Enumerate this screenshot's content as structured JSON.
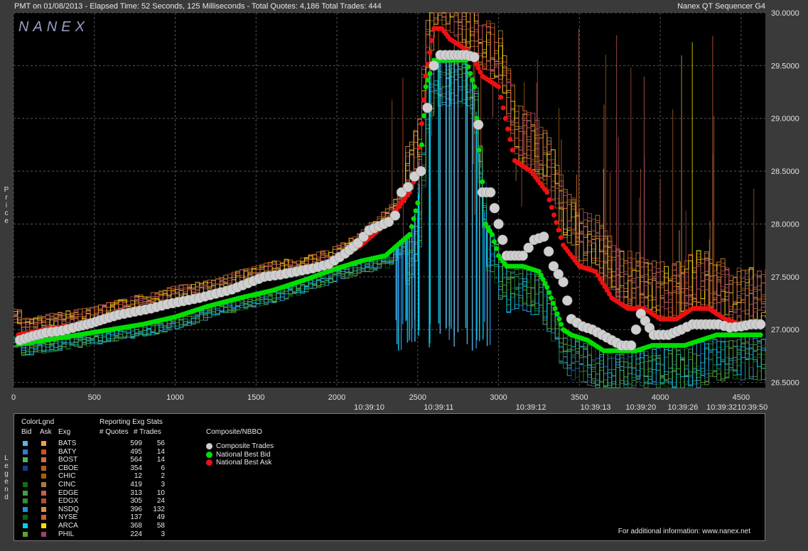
{
  "header": {
    "info": "PMT on 01/08/2013  -  Elapsed Time: 52 Seconds, 125 Milliseconds  -  Total Quotes: 4,186  Total Trades: 444",
    "product": "Nanex QT Sequencer G4",
    "logo": "NANEX"
  },
  "side_labels": {
    "price": "Price",
    "legend": "Legend"
  },
  "colors": {
    "background": "#000000",
    "trades": "#cfcfcf",
    "bid": "#00e000",
    "ask": "#ee1010"
  },
  "chart_data": {
    "type": "scatter",
    "xlim": [
      0,
      4650
    ],
    "ylim": [
      26.45,
      30.0
    ],
    "y_ticks": [
      "30.0000",
      "29.5000",
      "29.0000",
      "28.5000",
      "28.0000",
      "27.5000",
      "27.0000",
      "26.5000"
    ],
    "x_ticks": [
      "0",
      "500",
      "1000",
      "1500",
      "2000",
      "2500",
      "3000",
      "3500",
      "4000",
      "4500"
    ],
    "time_labels": [
      {
        "x": 2200,
        "label": "10:39:10"
      },
      {
        "x": 2630,
        "label": "10:39:11"
      },
      {
        "x": 3200,
        "label": "10:39:12"
      },
      {
        "x": 3600,
        "label": "10:39:13"
      },
      {
        "x": 3880,
        "label": "10:39:20"
      },
      {
        "x": 4140,
        "label": "10:39:26"
      },
      {
        "x": 4380,
        "label": "10:39:32"
      },
      {
        "x": 4570,
        "label": "10:39:50"
      }
    ],
    "series": [
      {
        "name": "Composite Trades",
        "points": [
          [
            40,
            26.9
          ],
          [
            120,
            26.94
          ],
          [
            200,
            26.97
          ],
          [
            300,
            26.99
          ],
          [
            400,
            27.03
          ],
          [
            480,
            27.06
          ],
          [
            560,
            27.1
          ],
          [
            650,
            27.14
          ],
          [
            750,
            27.17
          ],
          [
            850,
            27.2
          ],
          [
            950,
            27.24
          ],
          [
            1050,
            27.27
          ],
          [
            1150,
            27.3
          ],
          [
            1250,
            27.34
          ],
          [
            1350,
            27.38
          ],
          [
            1450,
            27.44
          ],
          [
            1550,
            27.5
          ],
          [
            1650,
            27.52
          ],
          [
            1750,
            27.55
          ],
          [
            1850,
            27.58
          ],
          [
            1950,
            27.62
          ],
          [
            2050,
            27.72
          ],
          [
            2130,
            27.82
          ],
          [
            2200,
            27.94
          ],
          [
            2260,
            27.98
          ],
          [
            2320,
            28.02
          ],
          [
            2360,
            28.08
          ],
          [
            2400,
            28.3
          ],
          [
            2440,
            28.35
          ],
          [
            2480,
            28.45
          ],
          [
            2520,
            28.5
          ],
          [
            2560,
            29.1
          ],
          [
            2600,
            29.5
          ],
          [
            2640,
            29.6
          ],
          [
            2700,
            29.6
          ],
          [
            2750,
            29.6
          ],
          [
            2800,
            29.6
          ],
          [
            2850,
            29.58
          ],
          [
            2900,
            28.3
          ],
          [
            2950,
            28.3
          ],
          [
            3000,
            28.0
          ],
          [
            3050,
            27.7
          ],
          [
            3100,
            27.7
          ],
          [
            3150,
            27.7
          ],
          [
            3220,
            27.85
          ],
          [
            3280,
            27.88
          ],
          [
            3340,
            27.6
          ],
          [
            3400,
            27.45
          ],
          [
            3450,
            27.1
          ],
          [
            3520,
            27.03
          ],
          [
            3580,
            27.0
          ],
          [
            3640,
            26.95
          ],
          [
            3700,
            26.9
          ],
          [
            3760,
            26.85
          ],
          [
            3820,
            26.85
          ],
          [
            3880,
            27.15
          ],
          [
            3960,
            26.95
          ],
          [
            4050,
            26.95
          ],
          [
            4130,
            27.0
          ],
          [
            4200,
            27.05
          ],
          [
            4280,
            27.05
          ],
          [
            4360,
            27.05
          ],
          [
            4430,
            27.02
          ],
          [
            4500,
            27.03
          ],
          [
            4560,
            27.05
          ],
          [
            4620,
            27.05
          ]
        ]
      },
      {
        "name": "National Best Bid",
        "points": [
          [
            30,
            26.86
          ],
          [
            200,
            26.9
          ],
          [
            400,
            26.95
          ],
          [
            600,
            27.0
          ],
          [
            800,
            27.05
          ],
          [
            1000,
            27.12
          ],
          [
            1200,
            27.22
          ],
          [
            1400,
            27.3
          ],
          [
            1600,
            27.37
          ],
          [
            1800,
            27.47
          ],
          [
            2000,
            27.58
          ],
          [
            2150,
            27.65
          ],
          [
            2300,
            27.7
          ],
          [
            2450,
            27.9
          ],
          [
            2500,
            28.2
          ],
          [
            2550,
            29.3
          ],
          [
            2600,
            29.55
          ],
          [
            2700,
            29.55
          ],
          [
            2800,
            29.55
          ],
          [
            2850,
            29.3
          ],
          [
            2880,
            28.7
          ],
          [
            2900,
            28.4
          ],
          [
            2920,
            28.0
          ],
          [
            2960,
            27.9
          ],
          [
            3000,
            27.7
          ],
          [
            3050,
            27.6
          ],
          [
            3150,
            27.6
          ],
          [
            3250,
            27.55
          ],
          [
            3300,
            27.4
          ],
          [
            3350,
            27.2
          ],
          [
            3400,
            27.0
          ],
          [
            3450,
            26.95
          ],
          [
            3550,
            26.9
          ],
          [
            3650,
            26.8
          ],
          [
            3750,
            26.8
          ],
          [
            3850,
            26.8
          ],
          [
            3950,
            26.85
          ],
          [
            4050,
            26.85
          ],
          [
            4150,
            26.85
          ],
          [
            4250,
            26.9
          ],
          [
            4350,
            26.95
          ],
          [
            4450,
            26.95
          ],
          [
            4550,
            26.95
          ],
          [
            4620,
            26.95
          ]
        ]
      },
      {
        "name": "National Best Ask",
        "points": [
          [
            30,
            26.95
          ],
          [
            200,
            27.0
          ],
          [
            400,
            27.05
          ],
          [
            600,
            27.12
          ],
          [
            800,
            27.2
          ],
          [
            1000,
            27.27
          ],
          [
            1200,
            27.32
          ],
          [
            1400,
            27.42
          ],
          [
            1600,
            27.5
          ],
          [
            1800,
            27.55
          ],
          [
            2000,
            27.65
          ],
          [
            2150,
            27.8
          ],
          [
            2300,
            28.0
          ],
          [
            2450,
            28.3
          ],
          [
            2500,
            28.5
          ],
          [
            2550,
            29.4
          ],
          [
            2600,
            29.85
          ],
          [
            2650,
            29.85
          ],
          [
            2700,
            29.75
          ],
          [
            2800,
            29.65
          ],
          [
            2850,
            29.55
          ],
          [
            2900,
            29.4
          ],
          [
            3000,
            29.3
          ],
          [
            3100,
            28.6
          ],
          [
            3200,
            28.5
          ],
          [
            3300,
            28.3
          ],
          [
            3400,
            27.8
          ],
          [
            3500,
            27.6
          ],
          [
            3600,
            27.55
          ],
          [
            3700,
            27.3
          ],
          [
            3800,
            27.2
          ],
          [
            3900,
            27.2
          ],
          [
            4000,
            27.1
          ],
          [
            4100,
            27.1
          ],
          [
            4200,
            27.2
          ],
          [
            4300,
            27.2
          ],
          [
            4400,
            27.1
          ],
          [
            4500,
            27.05
          ],
          [
            4620,
            27.05
          ]
        ]
      }
    ]
  },
  "legend": {
    "color_legend_title": "ColorLgnd",
    "stats_title": "Reporting Exg Stats",
    "col_bid": "Bid",
    "col_ask": "Ask",
    "col_exg": "Exg",
    "col_quotes": "# Quotes",
    "col_trades": "# Trades",
    "nbbo_title": "Composite/NBBO",
    "nbbo_items": [
      {
        "label": "Composite Trades",
        "color": "#cfcfcf"
      },
      {
        "label": "National Best Bid",
        "color": "#00e000"
      },
      {
        "label": "National Best Ask",
        "color": "#ee1010"
      }
    ],
    "exchanges": [
      {
        "exg": "BATS",
        "quotes": "599",
        "trades": "56",
        "bid_color": "#5ab4e8",
        "ask_color": "#f0a040"
      },
      {
        "exg": "BATY",
        "quotes": "495",
        "trades": "14",
        "bid_color": "#3a78c8",
        "ask_color": "#d05020"
      },
      {
        "exg": "BOST",
        "quotes": "564",
        "trades": "14",
        "bid_color": "#58b058",
        "ask_color": "#c87050"
      },
      {
        "exg": "CBOE",
        "quotes": "354",
        "trades": "6",
        "bid_color": "#1a3a90",
        "ask_color": "#b06020"
      },
      {
        "exg": "CHIC",
        "quotes": "12",
        "trades": "2",
        "bid_color": "#000000",
        "ask_color": "#a06010"
      },
      {
        "exg": "CINC",
        "quotes": "419",
        "trades": "3",
        "bid_color": "#107010",
        "ask_color": "#a08040"
      },
      {
        "exg": "EDGE",
        "quotes": "313",
        "trades": "10",
        "bid_color": "#40a040",
        "ask_color": "#c06050"
      },
      {
        "exg": "EDGX",
        "quotes": "305",
        "trades": "24",
        "bid_color": "#309030",
        "ask_color": "#b05030"
      },
      {
        "exg": "NSDQ",
        "quotes": "396",
        "trades": "132",
        "bid_color": "#2090e0",
        "ask_color": "#e09030"
      },
      {
        "exg": "NYSE",
        "quotes": "137",
        "trades": "49",
        "bid_color": "#106010",
        "ask_color": "#d06030"
      },
      {
        "exg": "ARCA",
        "quotes": "368",
        "trades": "58",
        "bid_color": "#00d0f0",
        "ask_color": "#f0e000"
      },
      {
        "exg": "PHIL",
        "quotes": "224",
        "trades": "3",
        "bid_color": "#60a030",
        "ask_color": "#a04070"
      }
    ],
    "footer": "For additional information: www.nanex.net"
  }
}
